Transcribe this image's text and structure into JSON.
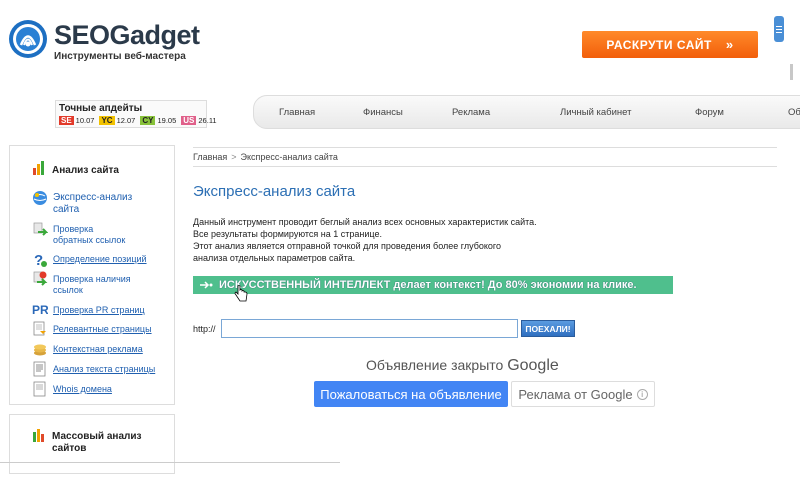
{
  "header": {
    "brand": "SEOGadget",
    "tagline": "Инструменты веб-мастера",
    "cta_label": "РАСКРУТИ САЙТ",
    "cta_arrows": "»"
  },
  "updates": {
    "title": "Точные апдейты",
    "items": [
      {
        "tag": "SE",
        "value": "10.07",
        "color": "#e23a2a"
      },
      {
        "tag": "YC",
        "value": "12.07",
        "color": "#f2c200"
      },
      {
        "tag": "CY",
        "value": "19.05",
        "color": "#88c23a"
      },
      {
        "tag": "US",
        "value": "26.11",
        "color": "#e0608a"
      }
    ]
  },
  "nav": {
    "items": [
      "Главная",
      "Финансы",
      "Реклама",
      "Личный кабинет",
      "Форум",
      "Об"
    ]
  },
  "sidebar": {
    "section_title": "Анализ сайта",
    "items": [
      {
        "label": "Экспресс-анализ сайта",
        "icon": "globe-icon"
      },
      {
        "label": "Проверка обратных ссылок",
        "icon": "links-icon"
      },
      {
        "label": "Определение позиций",
        "icon": "question-icon"
      },
      {
        "label": "Проверка наличия ссылок",
        "icon": "check-links-icon"
      },
      {
        "label": "Проверка PR страниц",
        "icon": "pr-icon"
      },
      {
        "label": "Релевантные страницы",
        "icon": "pages-icon"
      },
      {
        "label": "Контекстная реклама",
        "icon": "coins-icon"
      },
      {
        "label": "Анализ текста страницы",
        "icon": "text-icon"
      },
      {
        "label": "Whois домена",
        "icon": "whois-icon"
      }
    ],
    "section2_title": "Массовый анализ сайтов"
  },
  "main": {
    "breadcrumb_home": "Главная",
    "breadcrumb_sep": ">",
    "breadcrumb_current": "Экспресс-анализ сайта",
    "title": "Экспресс-анализ сайта",
    "desc_lines": [
      "Данный инструмент проводит беглый анализ всех основных характеристик сайта.",
      "Все результаты формируются на 1 странице.",
      "Этот анализ является отправной точкой для проведения более глубокого",
      "анализа отдельных параметров сайта."
    ],
    "banner": "ИСКУССТВЕННЫЙ ИНТЕЛЛЕКТ делает контекст! До 80% экономии на клике.",
    "http_label": "http://",
    "url_value": "",
    "go_label": "ПОЕХАЛИ!"
  },
  "ad": {
    "closed_text": "Объявление закрыто",
    "closed_brand": "Google",
    "report_label": "Пожаловаться на объявление",
    "google_label": "Реклама от Google",
    "info_glyph": "i"
  }
}
